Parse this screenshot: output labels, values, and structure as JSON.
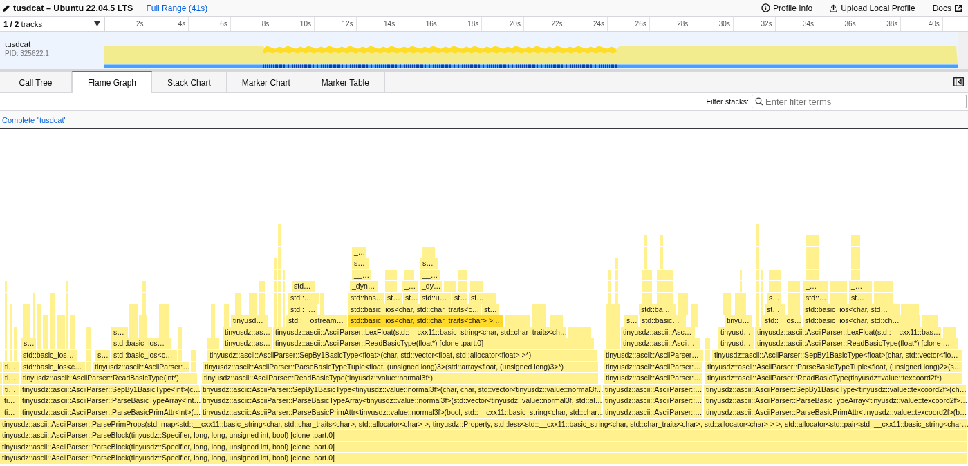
{
  "header": {
    "title": "tusdcat – Ubuntu 22.04.5 LTS",
    "range": "Full Range (41s)",
    "actions": [
      {
        "kind": "info",
        "label": "Profile Info"
      },
      {
        "kind": "upload",
        "label": "Upload Local Profile"
      },
      {
        "kind": "docs",
        "label": "Docs"
      }
    ]
  },
  "timeline": {
    "track_count": "**1 / 2** tracks",
    "ticks": [
      "2s",
      "4s",
      "6s",
      "8s",
      "10s",
      "12s",
      "14s",
      "16s",
      "18s",
      "20s",
      "22s",
      "24s",
      "26s",
      "28s",
      "30s",
      "32s",
      "34s",
      "36s",
      "38s",
      "40s"
    ],
    "tracks": [
      {
        "name": "tusdcat",
        "pid": "PID: 325622.1",
        "selected": true
      }
    ]
  },
  "tabs": [
    {
      "label": "Call Tree",
      "selected": false
    },
    {
      "label": "Flame Graph",
      "selected": true
    },
    {
      "label": "Stack Chart",
      "selected": false
    },
    {
      "label": "Marker Chart",
      "selected": false
    },
    {
      "label": "Marker Table",
      "selected": false
    }
  ],
  "filter": {
    "label": "Filter stacks:",
    "placeholder": "Enter filter terms"
  },
  "breadcrumb": "Complete \"tusdcat\"",
  "flame_graph": {
    "rows": [
      {
        "frames": [
          {
            "label": "_…",
            "selected": false
          }
        ]
      },
      {
        "frames": [
          {
            "label": "s…",
            "selected": false
          },
          {
            "label": "s…",
            "selected": false
          }
        ]
      },
      {
        "frames": [
          {
            "label": "__…",
            "selected": false
          },
          {
            "label": "__…",
            "selected": false
          }
        ]
      },
      {
        "frames": [
          {
            "label": "std…",
            "selected": false
          },
          {
            "label": "_dyn…",
            "selected": false
          },
          {
            "label": "_…",
            "selected": false
          },
          {
            "label": "_dy…",
            "selected": false
          },
          {
            "label": "_…",
            "selected": false
          },
          {
            "label": "_…",
            "selected": false
          }
        ]
      },
      {
        "frames": [
          {
            "label": "std::…",
            "selected": false
          },
          {
            "label": "std::has…",
            "selected": false
          },
          {
            "label": "st…",
            "selected": false
          },
          {
            "label": "st…",
            "selected": false
          },
          {
            "label": "std::u…",
            "selected": false
          },
          {
            "label": "st…",
            "selected": false
          },
          {
            "label": "st…",
            "selected": false
          },
          {
            "label": "s…",
            "selected": false
          },
          {
            "label": "std::…",
            "selected": false
          },
          {
            "label": "st…",
            "selected": false
          }
        ]
      },
      {
        "frames": [
          {
            "label": "std::_…",
            "selected": false
          },
          {
            "label": "std::basic_ios<char, std::char_traits<c…",
            "selected": false
          },
          {
            "label": "st…",
            "selected": false
          },
          {
            "label": "std::ba…",
            "selected": false
          },
          {
            "label": "st…",
            "selected": false
          },
          {
            "label": "std::basic_ios<char, std…",
            "selected": false
          }
        ]
      },
      {
        "frames": [
          {
            "label": "tinyusd…",
            "selected": false
          },
          {
            "label": "std::__ostream…",
            "selected": false
          },
          {
            "label": "std::basic_ios<char, std::char_traits<char> >:…",
            "selected": true
          },
          {
            "label": "s…",
            "selected": false
          },
          {
            "label": "std::basic…",
            "selected": false
          },
          {
            "label": "tinyu…",
            "selected": false
          },
          {
            "label": "std::__os…",
            "selected": false
          },
          {
            "label": "std::basic_ios<char, std::ch…",
            "selected": false
          }
        ]
      },
      {
        "frames": [
          {
            "label": "s…",
            "selected": false
          },
          {
            "label": "tinyusdz::as…",
            "selected": false
          },
          {
            "label": "tinyusdz::ascii::AsciiParser::LexFloat(std::__cxx11::basic_string<char, std::char_traits<ch…",
            "selected": false
          },
          {
            "label": "tinyusdz::ascii::Asc…",
            "selected": false
          },
          {
            "label": "tinyusd…",
            "selected": false
          },
          {
            "label": "tinyusdz::ascii::AsciiParser::LexFloat(std::__cxx11::bas…",
            "selected": false
          }
        ]
      },
      {
        "frames": [
          {
            "label": "s…",
            "selected": false
          },
          {
            "label": "std::basic_ios…",
            "selected": false
          },
          {
            "label": "tinyusdz::as…",
            "selected": false
          },
          {
            "label": "tinyusdz::ascii::AsciiParser::ReadBasicType(float*) [clone .part.0]",
            "selected": false
          },
          {
            "label": "tinyusdz::ascii::Ascii…",
            "selected": false
          },
          {
            "label": "tinyusd…",
            "selected": false
          },
          {
            "label": "tinyusdz::ascii::AsciiParser::ReadBasicType(float*) [clone ….",
            "selected": false
          }
        ]
      },
      {
        "frames": [
          {
            "label": "std::basic_ios…",
            "selected": false
          },
          {
            "label": "s…",
            "selected": false
          },
          {
            "label": "std::basic_ios<c…",
            "selected": false
          },
          {
            "label": "tinyusdz::ascii::AsciiParser::SepBy1BasicType<float>(char, std::vector<float, std::allocator<float> >*)",
            "selected": false
          },
          {
            "label": "tinyusdz::ascii::AsciiParser…",
            "selected": false
          },
          {
            "label": "tinyusdz::ascii::AsciiParser::SepBy1BasicType<float>(char, std::vector<flo…",
            "selected": false
          }
        ]
      },
      {
        "frames": [
          {
            "label": "ti…",
            "selected": false
          },
          {
            "label": "std::basic_ios<c…",
            "selected": false
          },
          {
            "label": "tinyusdz::ascii::AsciiParser:…",
            "selected": false
          },
          {
            "label": "tinyusdz::ascii::AsciiParser::ParseBasicTypeTuple<float, (unsigned long)3>(std::array<float, (unsigned long)3>*)",
            "selected": false
          },
          {
            "label": "tinyusdz::ascii::AsciiParser:…",
            "selected": false
          },
          {
            "label": "tinyusdz::ascii::AsciiParser::ParseBasicTypeTuple<float, (unsigned long)2>(s…",
            "selected": false
          }
        ]
      },
      {
        "frames": [
          {
            "label": "ti…",
            "selected": false
          },
          {
            "label": "tinyusdz::ascii::AsciiParser::ReadBasicType(int*)",
            "selected": false
          },
          {
            "label": "tinyusdz::ascii::AsciiParser::ReadBasicType(tinyusdz::value::normal3f*)",
            "selected": false
          },
          {
            "label": "tinyusdz::ascii::AsciiParser:…",
            "selected": false
          },
          {
            "label": "tinyusdz::ascii::AsciiParser::ReadBasicType(tinyusdz::value::texcoord2f*)",
            "selected": false
          }
        ]
      },
      {
        "frames": [
          {
            "label": "ti…",
            "selected": false
          },
          {
            "label": "tinyusdz::ascii::AsciiParser::SepBy1BasicType<int>(c…",
            "selected": false
          },
          {
            "label": "tinyusdz::ascii::AsciiParser::SepBy1BasicType<tinyusdz::value::normal3f>(char, char, std::vector<tinyusdz::value::normal3f…",
            "selected": false
          },
          {
            "label": "tinyusdz::ascii::AsciiParser::…",
            "selected": false
          },
          {
            "label": "tinyusdz::ascii::AsciiParser::SepBy1BasicType<tinyusdz::value::texcoord2f>(ch…",
            "selected": false
          }
        ]
      },
      {
        "frames": [
          {
            "label": "ti…",
            "selected": false
          },
          {
            "label": "tinyusdz::ascii::AsciiParser::ParseBasicTypeArray<int…",
            "selected": false
          },
          {
            "label": "tinyusdz::ascii::AsciiParser::ParseBasicTypeArray<tinyusdz::value::normal3f>(std::vector<tinyusdz::value::normal3f, std::al…",
            "selected": false
          },
          {
            "label": "tinyusdz::ascii::AsciiParser::…",
            "selected": false
          },
          {
            "label": "tinyusdz::ascii::AsciiParser::ParseBasicTypeArray<tinyusdz::value::texcoord2f>…",
            "selected": false
          }
        ]
      },
      {
        "frames": [
          {
            "label": "ti…",
            "selected": false
          },
          {
            "label": "tinyusdz::ascii::AsciiParser::ParseBasicPrimAttr<int>(…",
            "selected": false
          },
          {
            "label": "tinyusdz::ascii::AsciiParser::ParseBasicPrimAttr<tinyusdz::value::normal3f>(bool, std::__cxx11::basic_string<char, std::char…",
            "selected": false
          },
          {
            "label": "tinyusdz::ascii::AsciiParser::…",
            "selected": false
          },
          {
            "label": "tinyusdz::ascii::AsciiParser::ParseBasicPrimAttr<tinyusdz::value::texcoord2f>(b…",
            "selected": false
          }
        ]
      },
      {
        "frames": [
          {
            "label": "tinyusdz::ascii::AsciiParser::ParsePrimProps(std::map<std::__cxx11::basic_string<char, std::char_traits<char>, std::allocator<char> >, tinyusdz::Property, std::less<std::__cxx11::basic_string<char, std::char_traits<char>, std::allocator<char> > >, std::allocator<std::pair<std::__cxx11::basic_string<char…",
            "selected": false
          }
        ]
      },
      {
        "frames": [
          {
            "label": "tinyusdz::ascii::AsciiParser::ParseBlock(tinyusdz::Specifier, long, long, unsigned int, bool) [clone .part.0]",
            "selected": false
          }
        ]
      },
      {
        "frames": [
          {
            "label": "tinyusdz::ascii::AsciiParser::ParseBlock(tinyusdz::Specifier, long, long, unsigned int, bool) [clone .part.0]",
            "selected": false
          }
        ]
      },
      {
        "frames": [
          {
            "label": "tinyusdz::ascii::AsciiParser::ParseBlock(tinyusdz::Specifier, long, long, unsigned int, bool) [clone .part.0]",
            "selected": false
          }
        ]
      }
    ]
  }
}
